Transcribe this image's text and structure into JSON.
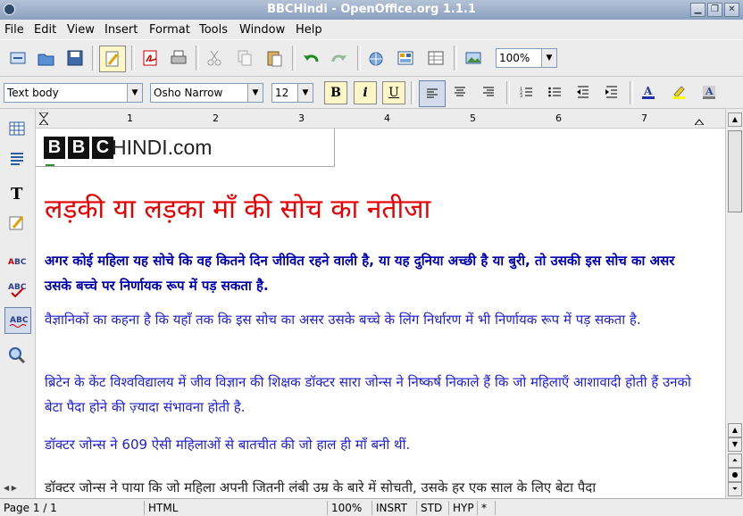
{
  "window": {
    "title": "BBCHindi - OpenOffice.org 1.1.1"
  },
  "menu": [
    "File",
    "Edit",
    "View",
    "Insert",
    "Format",
    "Tools",
    "Window",
    "Help"
  ],
  "toolbar": {
    "zoom": "100%"
  },
  "format": {
    "style": "Text body",
    "font": "Osho Narrow",
    "size": "12"
  },
  "ruler": [
    "1",
    "2",
    "3",
    "4",
    "5",
    "6",
    "7"
  ],
  "document": {
    "logo_bbc": [
      "B",
      "B",
      "C"
    ],
    "logo_text": "HINDI.com",
    "headline": "लड़की या लड़का माँ की सोच का नतीजा",
    "paragraphs": [
      "अगर कोई महिला यह सोचे कि वह कितने दिन जीवित रहने वाली है, या यह दुनिया अच्छी है या बुरी, तो उसकी इस सोच का असर उसके बच्चे पर निर्णायक रूप में पड़ सकता है.",
      "वैज्ञानिकों का कहना है कि यहाँ तक कि इस सोच का असर उसके बच्चे के लिंग निर्धारण में भी निर्णायक रूप में पड़ सकता है.",
      "ब्रिटेन के केंट विश्वविद्यालय में जीव विज्ञान की शिक्षक डॉक्टर सारा जोन्स ने निष्कर्ष निकाले हैं कि जो महिलाएँ आशावादी होती हैं उनको बेटा पैदा होने की ज़्यादा संभावना होती है.",
      "डॉक्टर जोन्स ने 609 ऐसी महिलाओं से बातचीत की जो हाल ही माँ बनी थीं.",
      "डॉक्टर जोन्स ने पाया कि जो महिला अपनी जितनी लंबी उम्र के बारे में सोचती, उसके हर एक साल के लिए बेटा पैदा"
    ]
  },
  "status": {
    "page": "Page 1 / 1",
    "style": "HTML",
    "zoom": "100%",
    "insert": "INSRT",
    "sel": "STD",
    "hyp": "HYP",
    "mod": "*"
  }
}
